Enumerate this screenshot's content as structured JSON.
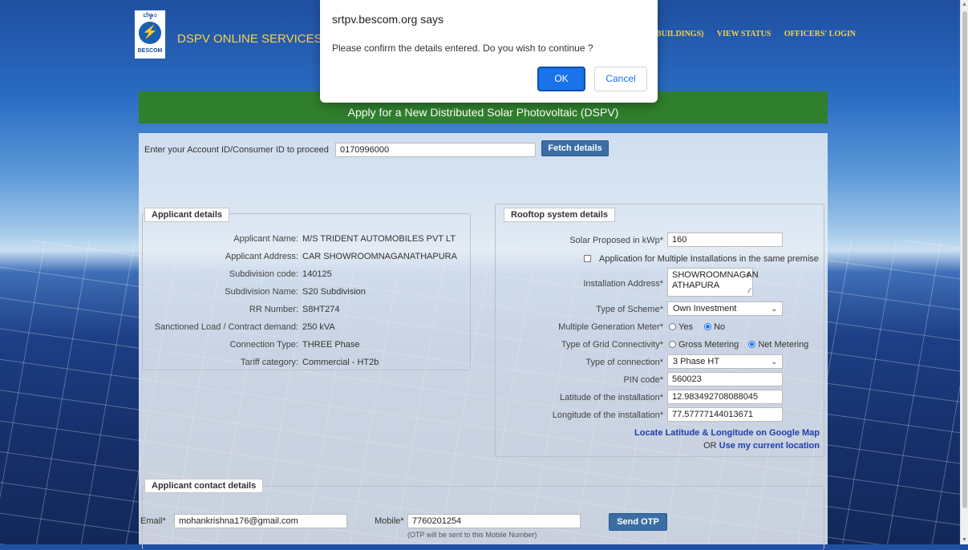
{
  "header": {
    "logo_top": "ಬೆಸ್ಕಾಂ",
    "logo_bottom": "BESCOM",
    "brand": "DSPV ONLINE SERVICES",
    "nav": [
      "BUILDINGS)",
      "VIEW STATUS",
      "OFFICERS' LOGIN"
    ]
  },
  "dialog": {
    "title": "srtpv.bescom.org says",
    "message": "Please confirm the details entered. Do you wish to continue ?",
    "ok_label": "OK",
    "cancel_label": "Cancel"
  },
  "banner": {
    "title": "Apply for a New Distributed Solar Photovoltaic (DSPV)"
  },
  "account": {
    "label": "Enter your Account ID/Consumer ID to proceed",
    "value": "0170996000",
    "fetch_label": "Fetch details"
  },
  "applicant": {
    "legend": "Applicant details",
    "rows": [
      {
        "label": "Applicant Name:",
        "value": "M/S TRIDENT AUTOMOBILES PVT LT"
      },
      {
        "label": "Applicant Address:",
        "value": "CAR SHOWROOMNAGANATHAPURA"
      },
      {
        "label": "Subdivision code:",
        "value": "140125"
      },
      {
        "label": "Subdivision Name:",
        "value": "S20 Subdivision"
      },
      {
        "label": "RR Number:",
        "value": "S8HT274"
      },
      {
        "label": "Sanctioned Load / Contract demand:",
        "value": "250 kVA"
      },
      {
        "label": "Connection Type:",
        "value": "THREE Phase"
      },
      {
        "label": "Tariff category:",
        "value": "Commercial - HT2b"
      }
    ]
  },
  "rooftop": {
    "legend": "Rooftop system details",
    "solar_label": "Solar Proposed in kWp*",
    "solar_value": "160",
    "multiple_install_label": "Application for Multiple Installations in the same premise",
    "address_label": "Installation Address*",
    "address_line1": "SHOWROOMNAGAN",
    "address_line2": "ATHAPURA",
    "scheme_label": "Type of Scheme*",
    "scheme_value": "Own Investment",
    "multi_meter_label": "Multiple Generation Meter*",
    "multi_meter_yes": "Yes",
    "multi_meter_no": "No",
    "grid_label": "Type of Grid Connectivity*",
    "grid_gross": "Gross Metering",
    "grid_net": "Net Metering",
    "connection_label": "Type of connection*",
    "connection_value": "3 Phase HT",
    "pin_label": "PIN code*",
    "pin_value": "560023",
    "lat_label": "Latitude of the installation*",
    "lat_value": "12.983492708088045",
    "lng_label": "Longitude of the installation*",
    "lng_value": "77.57777144013671",
    "map_link": "Locate Latitude & Longitude on Google Map",
    "or_text": "OR",
    "current_location_link": "Use my current location"
  },
  "contact": {
    "legend": "Applicant contact details",
    "email_label": "Email*",
    "email_value": "mohankrishna176@gmail.com",
    "mobile_label": "Mobile*",
    "mobile_value": "7760201254",
    "otp_note": "(OTP will be sent to this Mobile Number)",
    "send_otp_label": "Send OTP"
  }
}
